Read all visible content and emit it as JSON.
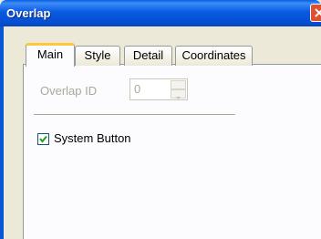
{
  "window": {
    "title": "Overlap"
  },
  "tabs": [
    {
      "label": "Main",
      "active": true
    },
    {
      "label": "Style",
      "active": false
    },
    {
      "label": "Detail",
      "active": false
    },
    {
      "label": "Coordinates",
      "active": false
    }
  ],
  "main": {
    "overlap_id_label": "Overlap ID",
    "overlap_id_value": "0",
    "system_button_label": "System Button",
    "system_button_checked": true
  },
  "colors": {
    "titlebar": "#0a5ae2",
    "tab_highlight": "#ffc83c",
    "checkmark": "#21a121"
  },
  "icons": {
    "close": "close-icon",
    "spin_up": "chevron-up-icon",
    "spin_down": "chevron-down-icon",
    "check": "check-icon"
  }
}
